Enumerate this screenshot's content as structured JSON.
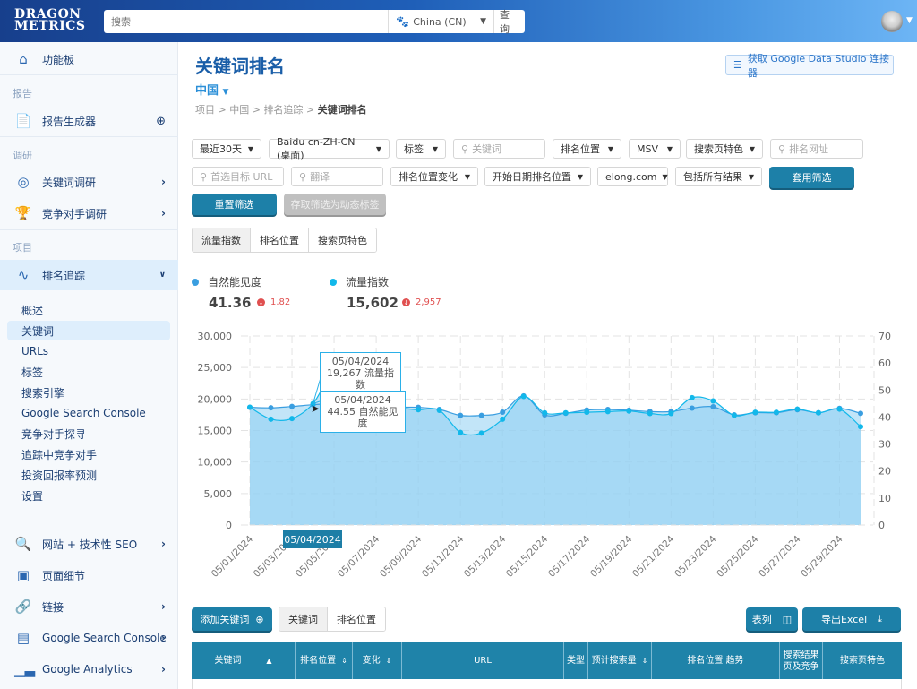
{
  "topbar": {
    "logo_line1": "DRAGON",
    "logo_line2": "METRICS",
    "search_placeholder": "搜索",
    "country": "China (CN)",
    "country_icon": "baidu-paw-icon",
    "search_button": "查询"
  },
  "sidebar": {
    "dashboard": "功能板",
    "section_reports": "报告",
    "report_builder": "报告生成器",
    "section_research": "调研",
    "keyword_research": "关键词调研",
    "competitor_research": "竞争对手调研",
    "section_projects": "项目",
    "rank_tracking": "排名追踪",
    "sub_items": [
      "概述",
      "关键词",
      "URLs",
      "标签",
      "搜索引擎",
      "Google Search Console",
      "竞争对手探寻",
      "追踪中竞争对手",
      "投资回报率预测",
      "设置"
    ],
    "active_sub": "关键词",
    "site_seo": "网站 + 技术性 SEO",
    "page_details": "页面细节",
    "links": "链接",
    "gsc": "Google Search Console",
    "ga": "Google Analytics"
  },
  "page": {
    "title": "关键词排名",
    "country": "中国",
    "breadcrumb": [
      "项目",
      "中国",
      "排名追踪",
      "关键词排名"
    ],
    "gds_button": "获取 Google Data Studio 连接器"
  },
  "filters": {
    "date_range": "最近30天",
    "engine": "Baidu cn-ZH-CN (桌面)",
    "tags": "标签",
    "keyword_placeholder": "关键词",
    "rank_position": "排名位置",
    "msv": "MSV",
    "serp_features": "搜索页特色",
    "rank_url_placeholder": "排名网址",
    "preferred_url_placeholder": "首选目标 URL",
    "translation_placeholder": "翻译",
    "rank_change": "排名位置变化",
    "start_date_rank": "开始日期排名位置",
    "domain": "elong.com",
    "include_results": "包括所有结果",
    "apply": "套用筛选",
    "reset": "重置筛选",
    "save_dynamic_tag": "存取筛选为动态标签"
  },
  "chart_tabs": [
    "流量指数",
    "排名位置",
    "搜索页特色"
  ],
  "active_chart_tab": "流量指数",
  "summary": {
    "visibility_label": "自然能见度",
    "visibility_value": "41.36",
    "visibility_delta": "1.82",
    "traffic_label": "流量指数",
    "traffic_value": "15,602",
    "traffic_delta": "2,957",
    "colors": {
      "visibility": "#3a9ee0",
      "traffic": "#12b8ea",
      "down": "#e05050"
    }
  },
  "tooltips": {
    "traffic_date": "05/04/2024",
    "traffic_text": "19,267 流量指数",
    "visibility_date": "05/04/2024",
    "visibility_text": "44.55 自然能见度",
    "x_flag": "05/04/2024"
  },
  "chart_data": {
    "type": "area",
    "title": "",
    "xlabel": "",
    "ylabel": "",
    "x": [
      "05/01/2024",
      "05/02/2024",
      "05/03/2024",
      "05/04/2024",
      "05/05/2024",
      "05/06/2024",
      "05/07/2024",
      "05/08/2024",
      "05/09/2024",
      "05/10/2024",
      "05/11/2024",
      "05/12/2024",
      "05/13/2024",
      "05/14/2024",
      "05/15/2024",
      "05/16/2024",
      "05/17/2024",
      "05/18/2024",
      "05/19/2024",
      "05/20/2024",
      "05/21/2024",
      "05/22/2024",
      "05/23/2024",
      "05/24/2024",
      "05/25/2024",
      "05/26/2024",
      "05/27/2024",
      "05/28/2024",
      "05/29/2024",
      "05/30/2024"
    ],
    "x_tick_labels": [
      "05/01/2024",
      "05/03/2024",
      "05/05/2024",
      "05/07/2024",
      "05/09/2024",
      "05/11/2024",
      "05/13/2024",
      "05/15/2024",
      "05/17/2024",
      "05/19/2024",
      "05/21/2024",
      "05/23/2024",
      "05/25/2024",
      "05/27/2024",
      "05/29/2024"
    ],
    "y_left": {
      "ylim": [
        0,
        30000
      ],
      "ticks": [
        "0",
        "5,000",
        "10,000",
        "15,000",
        "20,000",
        "25,000",
        "30,000"
      ]
    },
    "y_right": {
      "ylim": [
        0,
        70
      ],
      "ticks": [
        "0",
        "10",
        "20",
        "30",
        "40",
        "50",
        "60",
        "70"
      ]
    },
    "grid": true,
    "series": [
      {
        "name": "流量指数",
        "axis": "left",
        "color": "#12b8ea",
        "values": [
          18700,
          16800,
          16900,
          19267,
          24500,
          24000,
          18000,
          18500,
          18300,
          18200,
          14700,
          14600,
          16800,
          20400,
          17800,
          17800,
          17900,
          18000,
          18100,
          17700,
          17700,
          20200,
          19700,
          17400,
          17900,
          17900,
          18400,
          17800,
          18400,
          15600
        ]
      },
      {
        "name": "自然能见度",
        "axis": "right",
        "color": "#3a9ee0",
        "values": [
          43.6,
          43.4,
          43.9,
          44.55,
          45.0,
          44.5,
          43.8,
          43.6,
          43.6,
          42.8,
          40.6,
          40.6,
          41.8,
          47.8,
          40.8,
          41.4,
          42.6,
          42.8,
          42.5,
          42.0,
          42.0,
          43.3,
          43.8,
          40.8,
          41.6,
          41.6,
          42.7,
          41.6,
          43.2,
          41.36
        ]
      }
    ],
    "highlight": {
      "x": "05/04/2024",
      "traffic": 19267,
      "visibility": 44.55
    }
  },
  "table_toolbar": {
    "add_keyword": "添加关键词",
    "view_tabs": [
      "关键词",
      "排名位置"
    ],
    "active_view": "关键词",
    "columns_button": "表列",
    "export_button": "导出Excel"
  },
  "table": {
    "headers": [
      "关键词",
      "排名位置",
      "变化",
      "URL",
      "类型",
      "预计搜索量",
      "排名位置 趋势",
      "搜索结果\n页及竞争",
      "搜索页特色"
    ]
  }
}
